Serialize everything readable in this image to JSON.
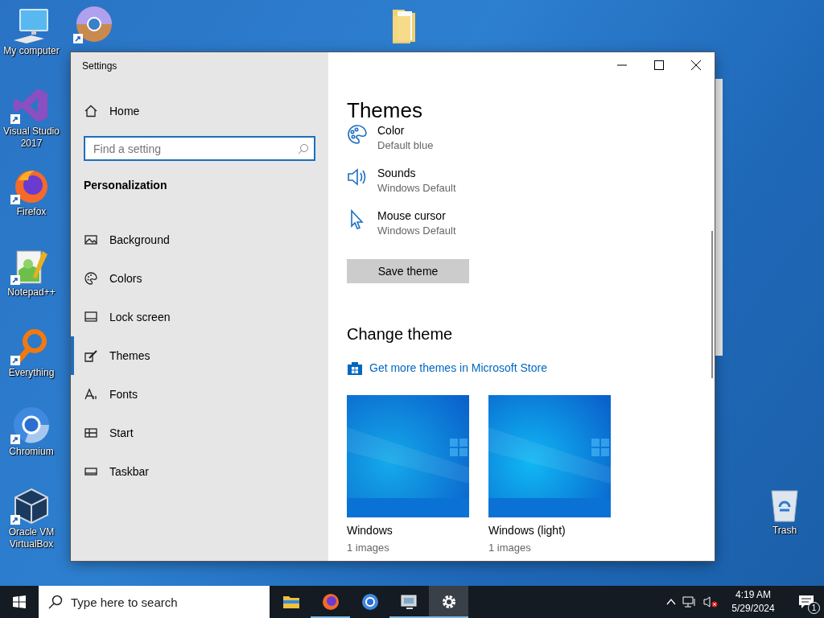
{
  "desktop_icons": [
    {
      "kind": "computer",
      "label": "My computer"
    },
    {
      "kind": "disc"
    },
    {
      "kind": "folder"
    },
    {
      "kind": "studio",
      "label": "Visual Studio 2017"
    },
    {
      "kind": "firefox",
      "label": "Firefox"
    },
    {
      "kind": "notepad",
      "label": "Notepad++"
    },
    {
      "kind": "everything",
      "label": "Everything"
    },
    {
      "kind": "chromium",
      "label": "Chromium"
    },
    {
      "kind": "virtualbox",
      "label": "Oracle VM VirtualBox"
    },
    {
      "kind": "trash",
      "label": "Trash"
    }
  ],
  "window": {
    "title": "Settings",
    "sidebar": {
      "home": "Home",
      "search": {
        "placeholder": "Find a setting"
      },
      "section": "Personalization",
      "items": [
        {
          "kind": "picture",
          "label": "Background",
          "selected": false
        },
        {
          "kind": "palette",
          "label": "Colors",
          "selected": false
        },
        {
          "kind": "lock",
          "label": "Lock screen",
          "selected": false
        },
        {
          "kind": "brush",
          "label": "Themes",
          "selected": true
        },
        {
          "kind": "font",
          "label": "Fonts",
          "selected": false
        },
        {
          "kind": "start",
          "label": "Start",
          "selected": false
        },
        {
          "kind": "taskbar",
          "label": "Taskbar",
          "selected": false
        }
      ]
    },
    "content": {
      "heading": "Themes",
      "settings": [
        {
          "kind": "palette",
          "label": "Color",
          "value": "Default blue"
        },
        {
          "kind": "speaker",
          "label": "Sounds",
          "value": "Windows Default"
        },
        {
          "kind": "cursor",
          "label": "Mouse cursor",
          "value": "Windows Default"
        }
      ],
      "save_button": "Save theme",
      "change_heading": "Change theme",
      "store_link": "Get more themes in Microsoft Store",
      "themes": [
        {
          "kind": "picture",
          "name": "Windows",
          "count": "1 images"
        },
        {
          "kind": "picture",
          "name": "Windows (light)",
          "count": "1 images"
        }
      ]
    }
  },
  "taskbar": {
    "search": {
      "placeholder": "Type here to search"
    },
    "apps": [
      {
        "kind": "explorer",
        "running": false,
        "selected": false
      },
      {
        "kind": "firefox",
        "running": true,
        "selected": false
      },
      {
        "kind": "chromium",
        "running": false,
        "selected": false
      },
      {
        "kind": "monitor",
        "running": true,
        "selected": false
      },
      {
        "kind": "settings",
        "running": true,
        "selected": true
      }
    ],
    "time": "4:19 AM",
    "date": "5/29/2024",
    "notifications": "1"
  }
}
